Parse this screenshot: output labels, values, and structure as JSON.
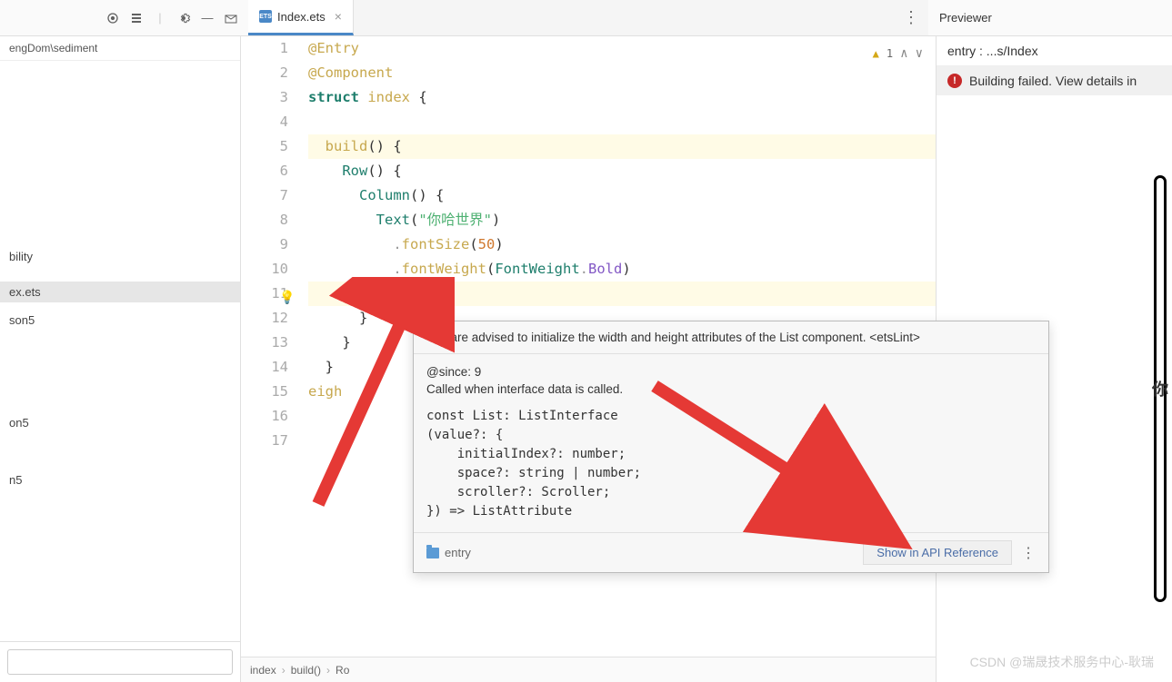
{
  "toolbar": {
    "tab_name": "Index.ets",
    "tab_icon_text": "ETS"
  },
  "sidebar": {
    "path": "engDom\\sediment",
    "items": [
      {
        "label": "bility"
      },
      {
        "label": "ex.ets"
      },
      {
        "label": "son5"
      },
      {
        "label": "on5"
      },
      {
        "label": "n5"
      }
    ]
  },
  "editor": {
    "warnings_count": "1",
    "lines": [
      {
        "num": 1,
        "seg": [
          {
            "t": "@Entry",
            "c": "k-decor"
          }
        ]
      },
      {
        "num": 2,
        "seg": [
          {
            "t": "@Component",
            "c": "k-decor"
          }
        ]
      },
      {
        "num": 3,
        "seg": [
          {
            "t": "struct ",
            "c": "k-keyword"
          },
          {
            "t": "index ",
            "c": "k-struct"
          },
          {
            "t": "{",
            "c": "k-brace"
          }
        ]
      },
      {
        "num": 4,
        "seg": []
      },
      {
        "num": 5,
        "seg": [
          {
            "t": "  ",
            "c": ""
          },
          {
            "t": "build",
            "c": "k-method"
          },
          {
            "t": "() ",
            "c": "k-brace"
          },
          {
            "t": "{",
            "c": "k-brace"
          }
        ],
        "hl": true
      },
      {
        "num": 6,
        "seg": [
          {
            "t": "    ",
            "c": ""
          },
          {
            "t": "Row",
            "c": "k-type"
          },
          {
            "t": "() ",
            "c": "k-brace"
          },
          {
            "t": "{",
            "c": "k-brace"
          }
        ]
      },
      {
        "num": 7,
        "seg": [
          {
            "t": "      ",
            "c": ""
          },
          {
            "t": "Column",
            "c": "k-type"
          },
          {
            "t": "() ",
            "c": "k-brace"
          },
          {
            "t": "{",
            "c": "k-brace"
          }
        ]
      },
      {
        "num": 8,
        "seg": [
          {
            "t": "        ",
            "c": ""
          },
          {
            "t": "Text",
            "c": "k-type"
          },
          {
            "t": "(",
            "c": "k-brace"
          },
          {
            "t": "\"你哈世界\"",
            "c": "k-string"
          },
          {
            "t": ")",
            "c": "k-brace"
          }
        ]
      },
      {
        "num": 9,
        "seg": [
          {
            "t": "          .",
            "c": "k-punc"
          },
          {
            "t": "fontSize",
            "c": "k-method"
          },
          {
            "t": "(",
            "c": "k-brace"
          },
          {
            "t": "50",
            "c": "k-number"
          },
          {
            "t": ")",
            "c": "k-brace"
          }
        ]
      },
      {
        "num": 10,
        "seg": [
          {
            "t": "          .",
            "c": "k-punc"
          },
          {
            "t": "fontWeight",
            "c": "k-method"
          },
          {
            "t": "(",
            "c": "k-brace"
          },
          {
            "t": "FontWeight",
            "c": "k-type"
          },
          {
            "t": ".",
            "c": "k-punc"
          },
          {
            "t": "Bold",
            "c": "k-prop"
          },
          {
            "t": ")",
            "c": "k-brace"
          }
        ]
      },
      {
        "num": 11,
        "seg": [
          {
            "t": "        ",
            "c": ""
          },
          {
            "t": "List",
            "c": "k-type"
          },
          {
            "t": "()",
            "c": "list-hl"
          }
        ],
        "hl": true
      },
      {
        "num": 12,
        "seg": [
          {
            "t": "      ",
            "c": ""
          },
          {
            "t": "}",
            "c": "k-brace"
          }
        ]
      },
      {
        "num": 13,
        "seg": [
          {
            "t": "    ",
            "c": ""
          },
          {
            "t": "}",
            "c": "k-brace"
          }
        ]
      },
      {
        "num": 14,
        "seg": [
          {
            "t": "  ",
            "c": ""
          },
          {
            "t": "}",
            "c": "k-brace"
          }
        ]
      },
      {
        "num": 15,
        "seg": [
          {
            "t": "eigh",
            "c": "k-method"
          }
        ]
      },
      {
        "num": 16,
        "seg": []
      },
      {
        "num": 17,
        "seg": []
      }
    ],
    "breadcrumb": [
      "index",
      "build()",
      "Ro"
    ]
  },
  "tooltip": {
    "header": "You are advised to initialize the width and height attributes of the List component. <etsLint>",
    "since": "@since: 9",
    "desc": "Called when interface data is called.",
    "code": "const List: ListInterface\n(value?: {\n    initialIndex?: number;\n    space?: string | number;\n    scroller?: Scroller;\n}) => ListAttribute",
    "module": "entry",
    "api_link": "Show in API Reference"
  },
  "previewer": {
    "title": "Previewer",
    "entry": "entry : ...s/Index",
    "error": "Building failed. View details in",
    "preview_text": "你"
  },
  "watermark": "CSDN @瑞晟技术服务中心-耿瑞"
}
